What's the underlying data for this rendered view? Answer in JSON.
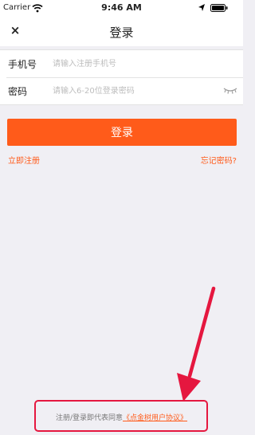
{
  "status_bar": {
    "carrier": "Carrier",
    "time": "9:46 AM"
  },
  "nav": {
    "close_label": "×",
    "title": "登录"
  },
  "form": {
    "phone_label": "手机号",
    "phone_placeholder": "请输入注册手机号",
    "phone_value": "",
    "password_label": "密码",
    "password_placeholder": "请输入6-20位登录密码",
    "password_value": ""
  },
  "actions": {
    "login_label": "登录",
    "register_label": "立即注册",
    "forgot_label": "忘记密码?"
  },
  "agreement": {
    "prefix": "注册/登录即代表同意",
    "link": "《点金树用户协议》"
  },
  "colors": {
    "accent": "#ff5b1a",
    "annotation": "#e5173f",
    "background": "#f0eff4"
  },
  "icons": [
    "wifi-icon",
    "location-arrow-icon",
    "battery-icon",
    "close-icon",
    "eye-hidden-icon"
  ]
}
